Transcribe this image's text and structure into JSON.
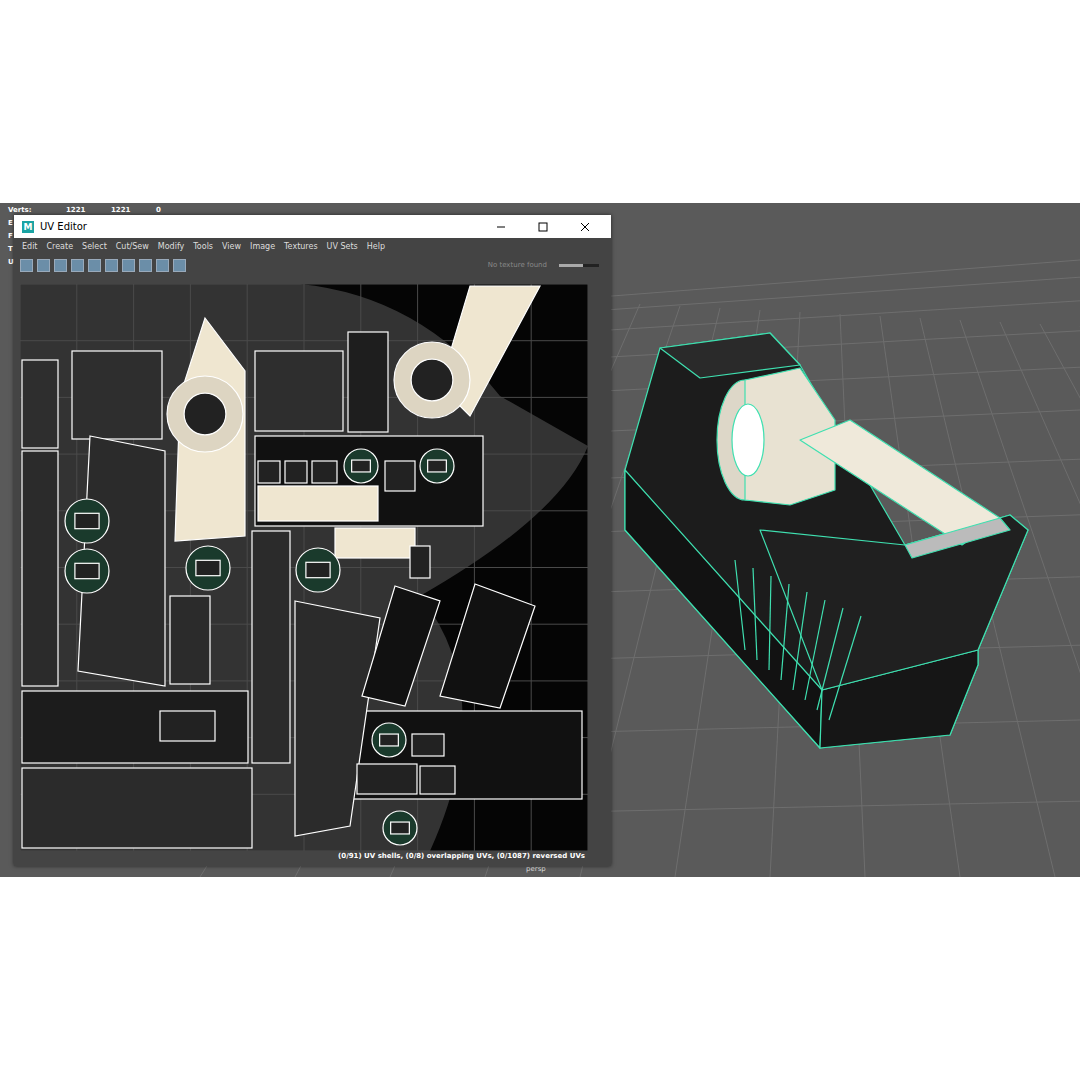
{
  "hud": {
    "label": "Verts:",
    "values": [
      "1221",
      "1221",
      "0"
    ],
    "cut_labels": [
      "E",
      "F",
      "T",
      "U"
    ]
  },
  "window": {
    "title": "UV Editor",
    "logo": "M"
  },
  "menu": [
    "Edit",
    "Create",
    "Select",
    "Cut/Sew",
    "Modify",
    "Tools",
    "View",
    "Image",
    "Textures",
    "UV Sets",
    "Help"
  ],
  "toolbar": {
    "texture_label": "No texture found",
    "slider_level": 0.6
  },
  "status_bar": "(0/91) UV shells, (0/8) overlapping UVs, (0/1087) reversed UVs",
  "viewport": {
    "camera": "persp"
  }
}
